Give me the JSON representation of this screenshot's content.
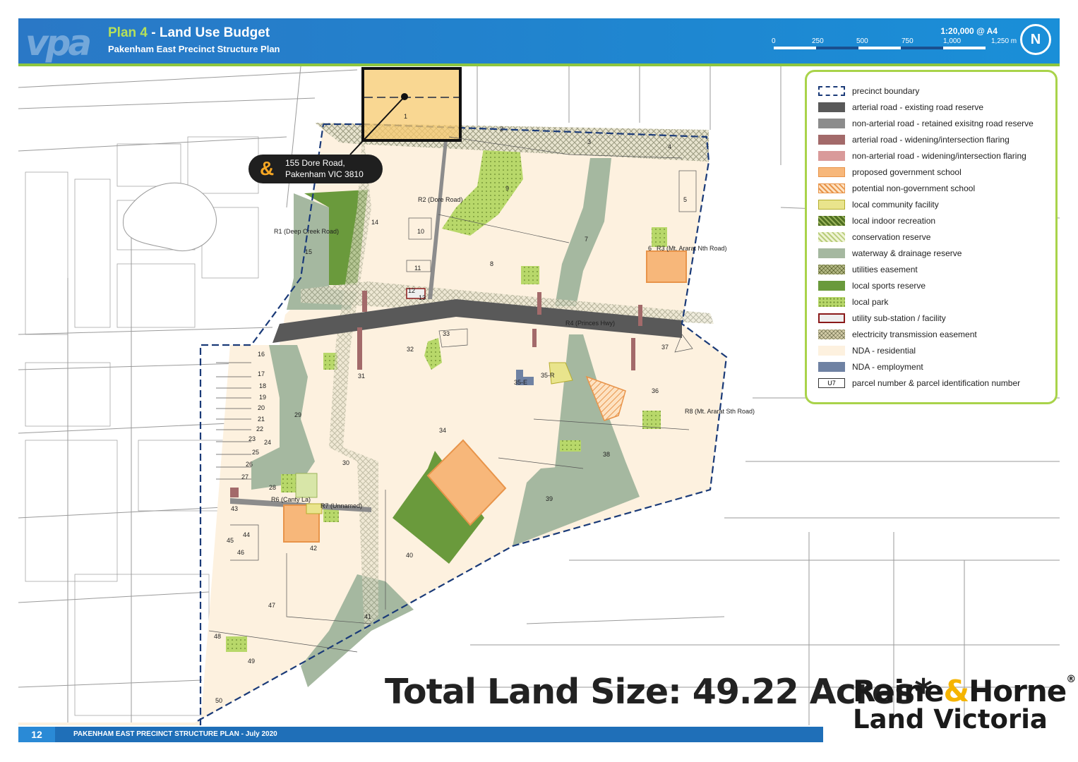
{
  "header": {
    "plan_number": "Plan 4",
    "plan_title": " - Land Use Budget",
    "subtitle": "Pakenham East Precinct Structure Plan",
    "scale": "1:20,000 @ A4",
    "scale_ticks": [
      "0",
      "250",
      "500",
      "750",
      "1,000",
      "1,250 m"
    ],
    "north": "N",
    "logo": "vpa"
  },
  "callout": {
    "icon": "&",
    "line1": "155 Dore Road,",
    "line2": "Pakenham VIC 3810"
  },
  "roads": {
    "r1": "R1 (Deep Creek Road)",
    "r2": "R2 (Dore Road)",
    "r3": "R3 (Mt. Ararat Nth Road)",
    "r4": "R4 (Princes Hwy)",
    "r6": "R6 (Canty La)",
    "r7": "R7 (Unnamed)",
    "r8": "R8 (Mt. Ararat Sth Road)"
  },
  "parcels": [
    "1",
    "2",
    "3",
    "4",
    "5",
    "6",
    "7",
    "8",
    "9",
    "10",
    "11",
    "12",
    "13",
    "14",
    "15",
    "16",
    "17",
    "18",
    "19",
    "20",
    "21",
    "22",
    "23",
    "24",
    "25",
    "26",
    "27",
    "28",
    "29",
    "30",
    "31",
    "32",
    "33",
    "34",
    "35-E",
    "35-R",
    "36",
    "37",
    "38",
    "39",
    "40",
    "41",
    "42",
    "43",
    "44",
    "45",
    "46",
    "47",
    "48",
    "49",
    "50"
  ],
  "legend": [
    {
      "label": "precinct boundary",
      "swatch": "boundary"
    },
    {
      "label": "arterial road - existing road reserve",
      "color": "#595959"
    },
    {
      "label": "non-arterial road - retained exisitng road reserve",
      "color": "#8c8c8c"
    },
    {
      "label": "arterial road - widening/intersection flaring",
      "color": "#a36a6a"
    },
    {
      "label": "non-arterial road - widening/intersection flaring",
      "color": "#d99a9a"
    },
    {
      "label": "proposed government school",
      "color": "#f7b77a"
    },
    {
      "label": "potential non-government school",
      "color": "#f7c08a"
    },
    {
      "label": "local community facility",
      "color": "#e9e48c"
    },
    {
      "label": "local indoor recreation",
      "color": "#7a9a3a"
    },
    {
      "label": "conservation reserve",
      "color": "#d8e6a8"
    },
    {
      "label": "waterway & drainage reserve",
      "color": "#a5b8a0"
    },
    {
      "label": "utilities easement",
      "color": "#d6d9b8"
    },
    {
      "label": "local sports reserve",
      "color": "#6a9a3c"
    },
    {
      "label": "local park",
      "color": "#b8d86a"
    },
    {
      "label": "utility sub-station / facility",
      "color": "#eeeeee"
    },
    {
      "label": "electricity transmission easement",
      "color": "#e8e4cf"
    },
    {
      "label": "NDA - residential",
      "color": "#fdf1df"
    },
    {
      "label": "NDA - employment",
      "color": "#6f82a3"
    },
    {
      "label": "parcel number & parcel identification number",
      "swatch": "parcel",
      "code": "U7"
    }
  ],
  "total_land": "Total Land Size: 49.22 Acres*",
  "brand": {
    "name_a": "Raine",
    "amp": "&",
    "name_b": "Horne",
    "mark": "®",
    "line2": "Land Victoria"
  },
  "footer": {
    "page": "12",
    "text": "PAKENHAM EAST PRECINCT STRUCTURE PLAN - July 2020"
  }
}
